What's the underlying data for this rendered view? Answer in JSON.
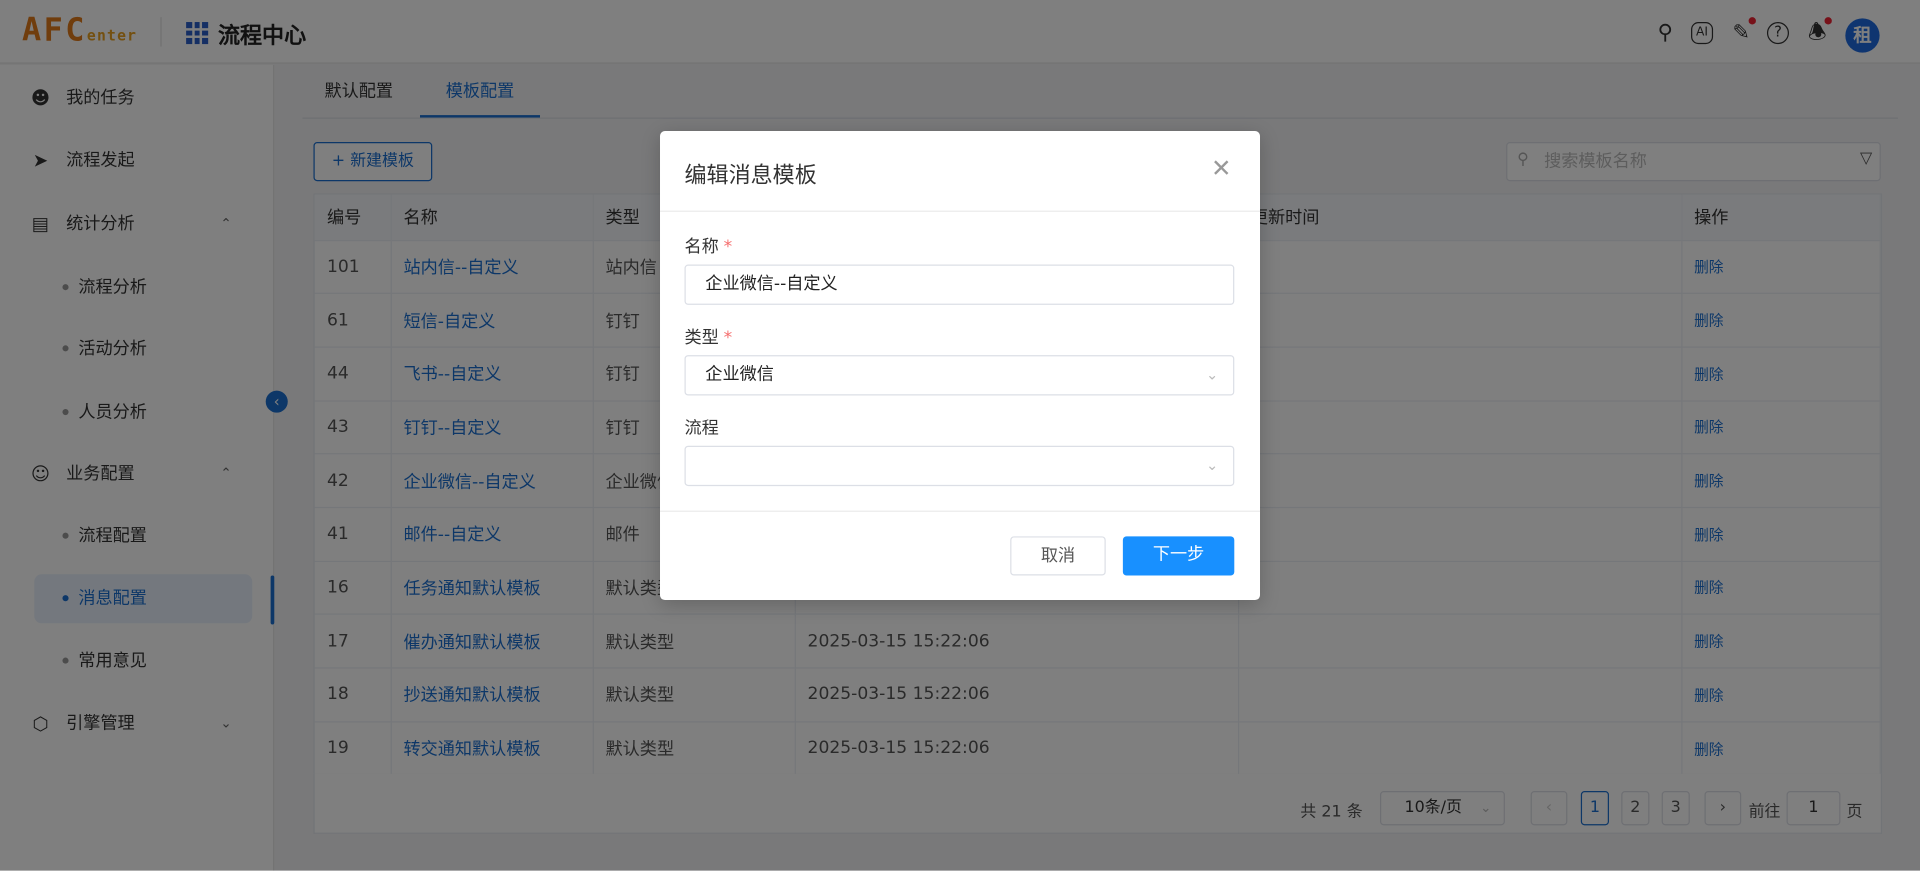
{
  "header": {
    "logo_main": "AFC",
    "logo_sub": "enter",
    "app_title": "流程中心",
    "avatar_text": "租",
    "icons": [
      "search-icon",
      "ai-icon",
      "document-edit-icon",
      "help-icon",
      "bell-icon"
    ]
  },
  "sidebar": {
    "items": [
      {
        "label": "我的任务",
        "icon": "user-icon"
      },
      {
        "label": "流程发起",
        "icon": "send-icon"
      },
      {
        "label": "统计分析",
        "icon": "stats-icon",
        "expanded": true
      },
      {
        "label": "流程分析"
      },
      {
        "label": "活动分析"
      },
      {
        "label": "人员分析"
      },
      {
        "label": "业务配置",
        "icon": "user-circle-icon",
        "expanded": true
      },
      {
        "label": "流程配置"
      },
      {
        "label": "消息配置",
        "active": true
      },
      {
        "label": "常用意见"
      },
      {
        "label": "引擎管理",
        "icon": "cube-icon",
        "expanded": false
      }
    ]
  },
  "tabs": [
    {
      "label": "默认配置"
    },
    {
      "label": "模板配置",
      "active": true
    }
  ],
  "toolbar": {
    "new_label": "新建模板",
    "search_placeholder": "搜索模板名称"
  },
  "table": {
    "headers": [
      "编号",
      "名称",
      "类型",
      "",
      "更新时间",
      "操作"
    ],
    "rows": [
      {
        "id": "101",
        "name": "站内信--自定义",
        "type": "站内信",
        "created": "",
        "op": "删除"
      },
      {
        "id": "61",
        "name": "短信-自定义",
        "type": "钉钉",
        "created": "",
        "op": "删除"
      },
      {
        "id": "44",
        "name": "飞书--自定义",
        "type": "钉钉",
        "created": "",
        "op": "删除"
      },
      {
        "id": "43",
        "name": "钉钉--自定义",
        "type": "钉钉",
        "created": "",
        "op": "删除"
      },
      {
        "id": "42",
        "name": "企业微信--自定义",
        "type": "企业微信",
        "created": "",
        "op": "删除"
      },
      {
        "id": "41",
        "name": "邮件--自定义",
        "type": "邮件",
        "created": "",
        "op": "删除"
      },
      {
        "id": "16",
        "name": "任务通知默认模板",
        "type": "默认类型",
        "created": "",
        "op": "删除"
      },
      {
        "id": "17",
        "name": "催办通知默认模板",
        "type": "默认类型",
        "created": "2025-03-15 15:22:06",
        "op": "删除"
      },
      {
        "id": "18",
        "name": "抄送通知默认模板",
        "type": "默认类型",
        "created": "2025-03-15 15:22:06",
        "op": "删除"
      },
      {
        "id": "19",
        "name": "转交通知默认模板",
        "type": "默认类型",
        "created": "2025-03-15 15:22:06",
        "op": "删除"
      }
    ]
  },
  "pagination": {
    "total": "共 21 条",
    "page_size": "10条/页",
    "pages": [
      "1",
      "2",
      "3"
    ],
    "current": "1",
    "goto_label": "前往",
    "goto_value": "1",
    "page_suffix": "页"
  },
  "modal": {
    "title": "编辑消息模板",
    "name_label": "名称",
    "name_value": "企业微信--自定义",
    "type_label": "类型",
    "type_value": "企业微信",
    "flow_label": "流程",
    "flow_value": "",
    "required_mark": "*",
    "cancel_label": "取消",
    "next_label": "下一步"
  },
  "colors": {
    "primary": "#1a6fd0",
    "button_primary": "#1890ff",
    "required": "#f56c6c",
    "logo": "#e07a1a"
  }
}
